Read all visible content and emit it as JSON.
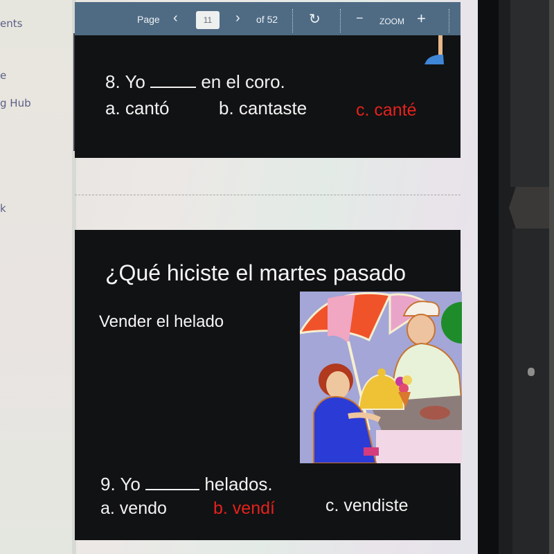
{
  "sidebar": {
    "items": [
      {
        "label": "ents"
      },
      {
        "label": "e"
      },
      {
        "label": "g Hub"
      },
      {
        "label": "k"
      }
    ]
  },
  "toolbar": {
    "page_label": "Page",
    "prev_icon": "‹",
    "current_page": "11",
    "next_icon": "›",
    "of_total": "of 52",
    "refresh_icon": "↻",
    "zoom_out_icon": "−",
    "zoom_label": "ZOOM",
    "zoom_in_icon": "+"
  },
  "slides": [
    {
      "question": {
        "number": "8.",
        "subject": "Yo",
        "rest": "en el coro.",
        "options": [
          {
            "label": "a.  cantó",
            "correct": false
          },
          {
            "label": "b. cantaste",
            "correct": false
          },
          {
            "label": "c. canté",
            "correct": true
          }
        ]
      }
    },
    {
      "title": "¿Qué hiciste el martes pasado",
      "subtitle": "Vender el helado",
      "image_alt": "Girl buying ice cream from a vendor under an umbrella",
      "question": {
        "number": "9.",
        "subject": "Yo",
        "rest": "helados.",
        "options": [
          {
            "label": "a. vendo",
            "correct": false
          },
          {
            "label": "b. vendí",
            "correct": true
          },
          {
            "label": "c.  vendiste",
            "correct": false
          }
        ]
      }
    }
  ],
  "colors": {
    "toolbar": "#4f6b84",
    "slide_bg": "#111213",
    "correct_answer": "#e5221d",
    "sidebar_text": "#5b5f86"
  }
}
